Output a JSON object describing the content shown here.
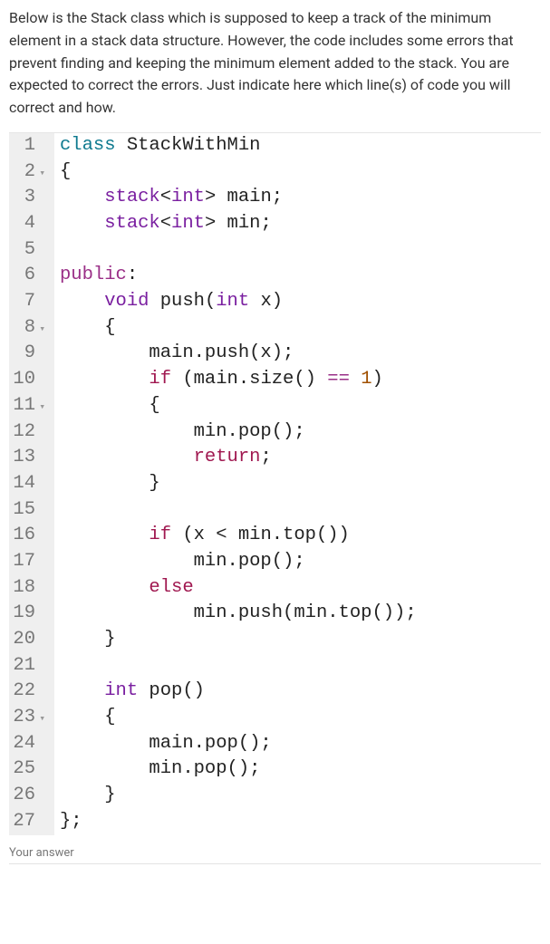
{
  "question": "Below is the Stack class which is supposed to keep a track of the minimum element in a stack data structure. However, the code includes some errors that prevent finding and keeping the minimum element added to the stack. You are expected to correct the errors. Just indicate here which line(s) of code you will correct and how.",
  "answer_label": "Your answer",
  "code": {
    "lines": [
      {
        "n": "1",
        "fold": false,
        "tokens": [
          {
            "t": "class ",
            "c": "kw-class"
          },
          {
            "t": "StackWithMin",
            "c": "ident"
          }
        ]
      },
      {
        "n": "2",
        "fold": true,
        "tokens": [
          {
            "t": "{",
            "c": "punct"
          }
        ]
      },
      {
        "n": "3",
        "fold": false,
        "tokens": [
          {
            "t": "    ",
            "c": ""
          },
          {
            "t": "stack",
            "c": "kw-type"
          },
          {
            "t": "<",
            "c": "punct"
          },
          {
            "t": "int",
            "c": "kw-type"
          },
          {
            "t": "> main;",
            "c": "punct"
          }
        ]
      },
      {
        "n": "4",
        "fold": false,
        "tokens": [
          {
            "t": "    ",
            "c": ""
          },
          {
            "t": "stack",
            "c": "kw-type"
          },
          {
            "t": "<",
            "c": "punct"
          },
          {
            "t": "int",
            "c": "kw-type"
          },
          {
            "t": "> min;",
            "c": "punct"
          }
        ]
      },
      {
        "n": "5",
        "fold": false,
        "tokens": [
          {
            "t": "",
            "c": ""
          }
        ]
      },
      {
        "n": "6",
        "fold": false,
        "tokens": [
          {
            "t": "public",
            "c": "kw-public"
          },
          {
            "t": ":",
            "c": "punct"
          }
        ]
      },
      {
        "n": "7",
        "fold": false,
        "tokens": [
          {
            "t": "    ",
            "c": ""
          },
          {
            "t": "void",
            "c": "kw-void"
          },
          {
            "t": " push(",
            "c": "punct"
          },
          {
            "t": "int",
            "c": "kw-type"
          },
          {
            "t": " x)",
            "c": "punct"
          }
        ]
      },
      {
        "n": "8",
        "fold": true,
        "tokens": [
          {
            "t": "    {",
            "c": "punct"
          }
        ]
      },
      {
        "n": "9",
        "fold": false,
        "tokens": [
          {
            "t": "        main.push(x);",
            "c": "ident"
          }
        ]
      },
      {
        "n": "10",
        "fold": false,
        "tokens": [
          {
            "t": "        ",
            "c": ""
          },
          {
            "t": "if",
            "c": "kw-return"
          },
          {
            "t": " (main.size() ",
            "c": "ident"
          },
          {
            "t": "==",
            "c": "op-eq"
          },
          {
            "t": " ",
            "c": ""
          },
          {
            "t": "1",
            "c": "num"
          },
          {
            "t": ")",
            "c": "punct"
          }
        ]
      },
      {
        "n": "11",
        "fold": true,
        "tokens": [
          {
            "t": "        {",
            "c": "punct"
          }
        ]
      },
      {
        "n": "12",
        "fold": false,
        "tokens": [
          {
            "t": "            min.pop();",
            "c": "ident"
          }
        ]
      },
      {
        "n": "13",
        "fold": false,
        "tokens": [
          {
            "t": "            ",
            "c": ""
          },
          {
            "t": "return",
            "c": "kw-return"
          },
          {
            "t": ";",
            "c": "punct"
          }
        ]
      },
      {
        "n": "14",
        "fold": false,
        "tokens": [
          {
            "t": "        }",
            "c": "punct"
          }
        ]
      },
      {
        "n": "15",
        "fold": false,
        "tokens": [
          {
            "t": "",
            "c": ""
          }
        ]
      },
      {
        "n": "16",
        "fold": false,
        "tokens": [
          {
            "t": "        ",
            "c": ""
          },
          {
            "t": "if",
            "c": "kw-return"
          },
          {
            "t": " (x < min.top())",
            "c": "ident"
          }
        ]
      },
      {
        "n": "17",
        "fold": false,
        "tokens": [
          {
            "t": "            min.pop();",
            "c": "ident"
          }
        ]
      },
      {
        "n": "18",
        "fold": false,
        "tokens": [
          {
            "t": "        ",
            "c": ""
          },
          {
            "t": "else",
            "c": "kw-return"
          }
        ]
      },
      {
        "n": "19",
        "fold": false,
        "tokens": [
          {
            "t": "            min.push(min.top());",
            "c": "ident"
          }
        ]
      },
      {
        "n": "20",
        "fold": false,
        "tokens": [
          {
            "t": "    }",
            "c": "punct"
          }
        ]
      },
      {
        "n": "21",
        "fold": false,
        "tokens": [
          {
            "t": "",
            "c": ""
          }
        ]
      },
      {
        "n": "22",
        "fold": false,
        "tokens": [
          {
            "t": "    ",
            "c": ""
          },
          {
            "t": "int",
            "c": "kw-type"
          },
          {
            "t": " pop()",
            "c": "ident"
          }
        ]
      },
      {
        "n": "23",
        "fold": true,
        "tokens": [
          {
            "t": "    {",
            "c": "punct"
          }
        ]
      },
      {
        "n": "24",
        "fold": false,
        "tokens": [
          {
            "t": "        main.pop();",
            "c": "ident"
          }
        ]
      },
      {
        "n": "25",
        "fold": false,
        "tokens": [
          {
            "t": "        min.pop();",
            "c": "ident"
          }
        ]
      },
      {
        "n": "26",
        "fold": false,
        "tokens": [
          {
            "t": "    }",
            "c": "punct"
          }
        ]
      },
      {
        "n": "27",
        "fold": false,
        "tokens": [
          {
            "t": "};",
            "c": "punct"
          }
        ]
      }
    ]
  }
}
